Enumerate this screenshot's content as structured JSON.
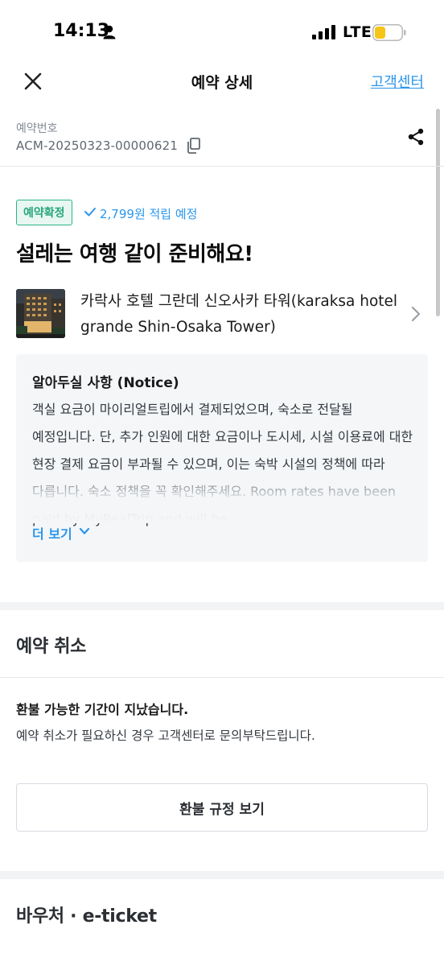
{
  "status_bar": {
    "time": "14:13",
    "network": "LTE",
    "battery_color": "#f5c518"
  },
  "nav": {
    "title": "예약 상세",
    "support_link": "고객센터"
  },
  "booking": {
    "number_label": "예약번호",
    "number_value": "ACM-20250323-00000621"
  },
  "status": {
    "badge": "예약확정",
    "points": "2,799원 적립 예정",
    "headline": "설레는 여행 같이 준비해요!"
  },
  "hotel": {
    "name": "카락사 호텔 그란데 신오사카 타워(karaksa hotel grande Shin-Osaka Tower)"
  },
  "notice": {
    "title": "알아두실 사항 (Notice)",
    "body": "객실 요금이 마이리얼트립에서 결제되었으며, 숙소로 전달될 예정입니다. 단, 추가 인원에 대한 요금이나 도시세, 시설 이용료에 대한 현장 결제 요금이 부과될 수 있으며, 이는 숙박 시설의 정책에 따라 다릅니다. 숙소 정책을 꼭 확인해주세요. Room rates have been paid by MyRealTrip and will be",
    "more_label": "더 보기"
  },
  "cancel_section": {
    "title": "예약 취소",
    "notice_title": "환불 가능한 기간이 지났습니다.",
    "notice_body": "예약 취소가 필요하신 경우 고객센터로 문의부탁드립니다.",
    "policy_button": "환불 규정 보기"
  },
  "voucher_section": {
    "title": "바우처 · e-ticket"
  },
  "colors": {
    "accent_blue": "#2b96ed",
    "confirmed_green": "#27a57b",
    "notice_bg": "#f4f6f8"
  },
  "icons": [
    "person-icon",
    "signal-icon",
    "battery-icon",
    "close-icon",
    "copy-icon",
    "share-icon",
    "check-icon",
    "chevron-right-icon",
    "chevron-down-icon"
  ]
}
